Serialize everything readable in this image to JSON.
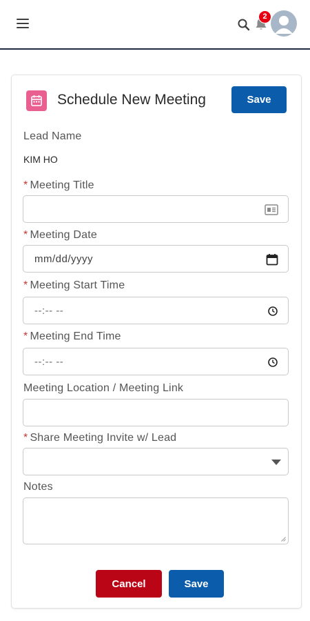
{
  "header": {
    "menu_icon": "hamburger-icon",
    "search_icon": "search-icon",
    "bell_icon": "bell-icon",
    "notification_count": "2",
    "avatar_icon": "user-avatar-icon"
  },
  "form": {
    "title": "Schedule New Meeting",
    "title_icon": "calendar-icon",
    "save_label": "Save",
    "cancel_label": "Cancel",
    "required_marker": "*",
    "lead_name": {
      "label": "Lead Name",
      "value": "KIM HO"
    },
    "meeting_title": {
      "label": "Meeting Title",
      "value": "",
      "icon": "contact-card-icon"
    },
    "meeting_date": {
      "label": "Meeting Date",
      "placeholder": "mm/dd/yyyy",
      "icon": "calendar-icon"
    },
    "start_time": {
      "label": "Meeting Start Time",
      "placeholder": "--:-- --",
      "icon": "clock-icon"
    },
    "end_time": {
      "label": "Meeting End Time",
      "placeholder": "--:-- --",
      "icon": "clock-icon"
    },
    "location": {
      "label": "Meeting Location / Meeting Link",
      "value": ""
    },
    "share_invite": {
      "label": "Share Meeting Invite w/ Lead",
      "value": "",
      "icon": "caret-down-icon"
    },
    "notes": {
      "label": "Notes",
      "value": ""
    }
  },
  "colors": {
    "primary": "#0b5cab",
    "danger": "#ba0517",
    "required": "#c23934",
    "badge": "#e60012",
    "icon_pink": "#e96090",
    "header_border": "#1e2a44"
  }
}
